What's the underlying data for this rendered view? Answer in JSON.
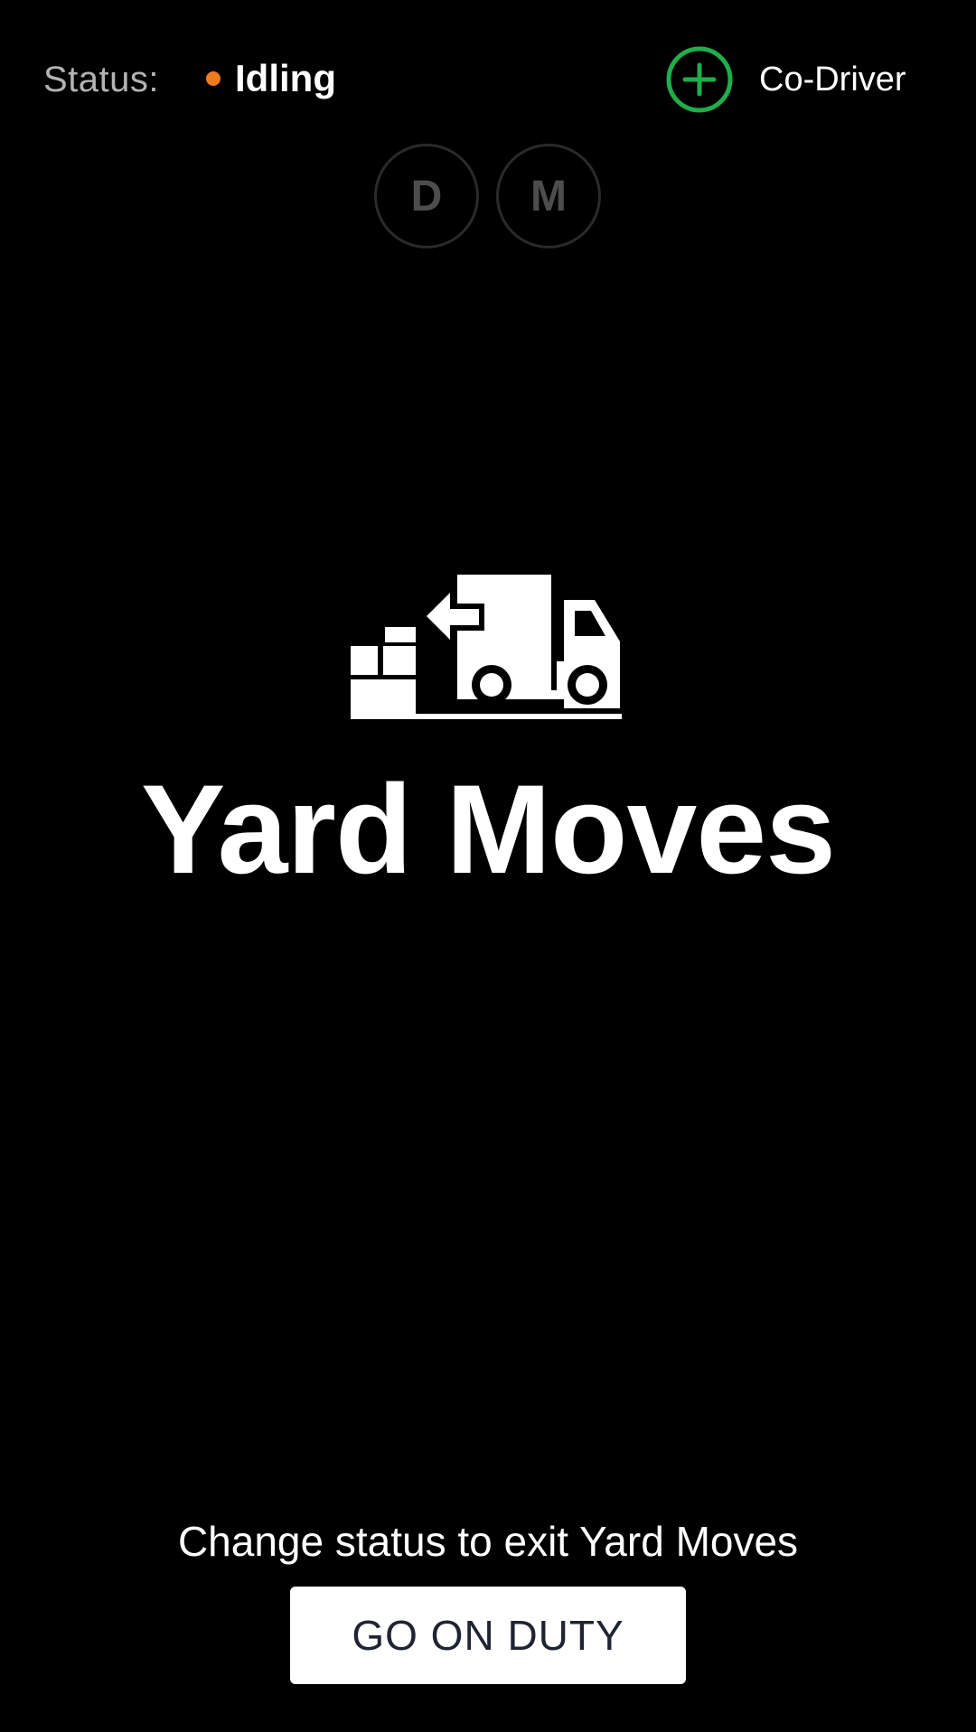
{
  "header": {
    "status_label": "Status:",
    "status_value": "Idling",
    "status_color": "#f07a1e",
    "codriver_label": "Co-Driver",
    "codriver_accent": "#1fae4b"
  },
  "driver_buttons": [
    "D",
    "M"
  ],
  "main": {
    "icon": "yard-moves-truck-icon",
    "title": "Yard Moves"
  },
  "footer": {
    "hint": "Change status to exit Yard Moves",
    "button_label": "GO ON DUTY"
  }
}
